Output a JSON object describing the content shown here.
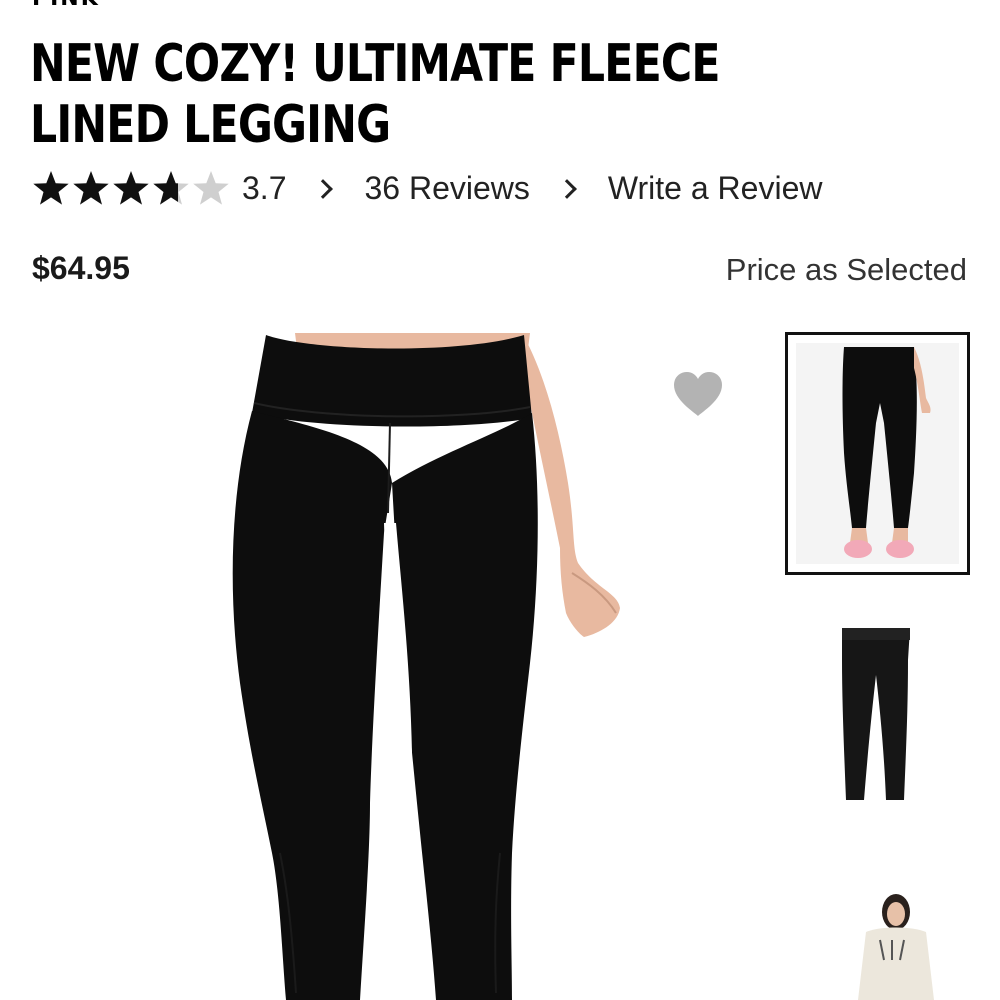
{
  "brand": "PINK",
  "product": {
    "title": "NEW COZY! ULTIMATE FLEECE LINED LEGGING",
    "rating_value": "3.7",
    "rating": 3.7,
    "reviews_label": "36 Reviews",
    "write_review_label": "Write a Review",
    "price": "$64.95",
    "price_note": "Price as Selected"
  },
  "icons": {
    "star": "star-icon",
    "chevron": "chevron-right-icon",
    "heart": "heart-icon"
  },
  "colors": {
    "star_filled": "#111111",
    "star_empty": "#cfcfcf",
    "heart": "#b3b3b3",
    "garment": "#0d0d0d",
    "skin": "#e8b9a0",
    "thumb_selected_border": "#111111"
  },
  "thumbnails": [
    {
      "name": "model-front",
      "selected": true
    },
    {
      "name": "flat-lay",
      "selected": false
    },
    {
      "name": "model-sweatshirt",
      "selected": false
    }
  ]
}
